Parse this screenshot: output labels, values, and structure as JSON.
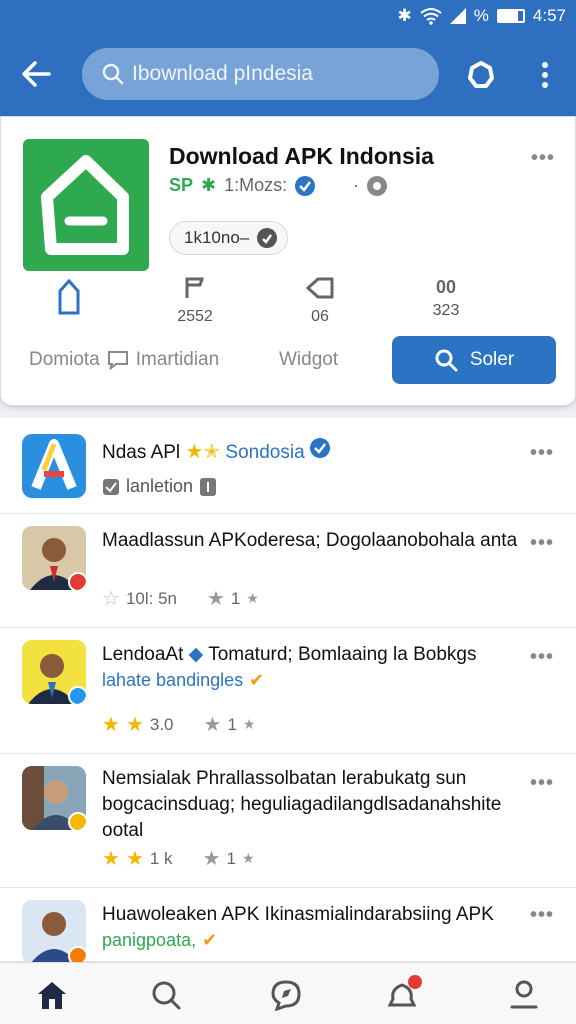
{
  "status": {
    "battery": "%",
    "time": "4:57"
  },
  "header": {
    "search_value": "Ibownload pIndesia"
  },
  "hero": {
    "title": "Download APK Indonsia",
    "meta_brand": "SP",
    "meta_count": "1:Mozs:",
    "chip_label": "1k10no–",
    "stats": [
      "2552",
      "06",
      "323"
    ],
    "stat_labels": [
      "",
      "",
      "00"
    ],
    "tab_1": "Domiota",
    "tab_2": "Imartidian",
    "tab_3": "Widgot",
    "primary_button": "Soler"
  },
  "list": [
    {
      "title_start": "Ndas APl",
      "title_blue": "Sondosia",
      "sub": "lanletion",
      "rating_1": "",
      "rating_2": ""
    },
    {
      "title": "Maadlassun APKoderesa; Dogolaanobohala anta",
      "rating_1": "10l: 5n",
      "rating_2": "1"
    },
    {
      "title": "LendoaAt",
      "title_rest": "Tomaturd; Bomlaaing la Bobkgs",
      "sub": "lahate bandingles",
      "rating_1": "3.0",
      "rating_2": "1"
    },
    {
      "title": "Nemsialak Phrallassolbatan lerabukatg sun bogcacinsduag; heguliagadilangdlsadanahshite ootal",
      "rating_1": "1 k",
      "rating_2": "1"
    },
    {
      "title": "Huawoleaken APK Ikinasmialindarabsiing APK",
      "sub": "panigpoata,",
      "rating_1": "",
      "rating_2": ""
    }
  ],
  "nav": [
    "home",
    "search",
    "explore",
    "notifications",
    "profile"
  ],
  "colors": {
    "primary": "#2f6fbf",
    "accent_green": "#2fa94f",
    "star": "#f5b700"
  }
}
